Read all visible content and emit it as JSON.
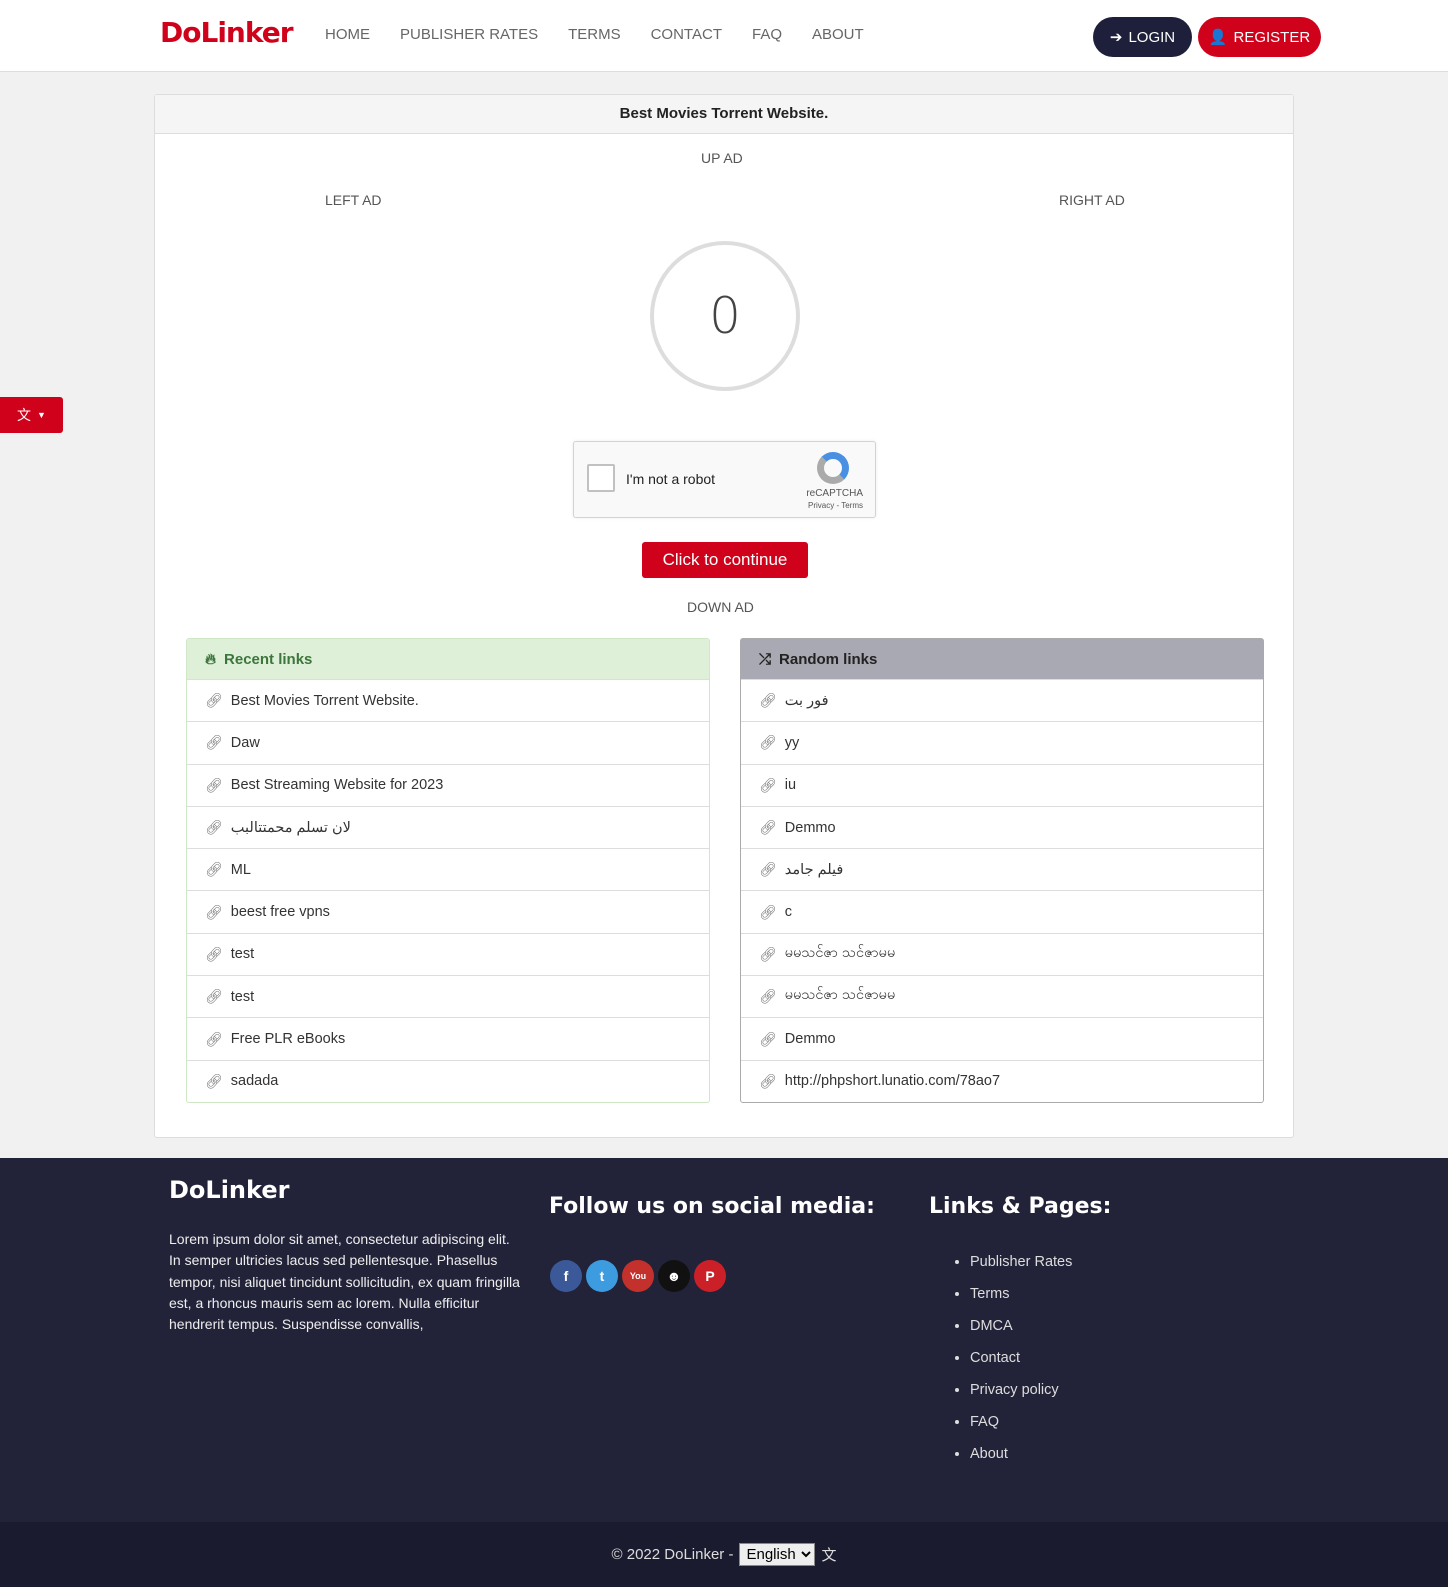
{
  "nav": {
    "logo": "DoLinker",
    "items": [
      "HOME",
      "PUBLISHER RATES",
      "TERMS",
      "CONTACT",
      "FAQ",
      "ABOUT"
    ],
    "login": "LOGIN",
    "register": "REGISTER"
  },
  "card": {
    "title": "Best Movies Torrent Website.",
    "up_ad": "UP AD",
    "left_ad": "LEFT AD",
    "right_ad": "RIGHT AD",
    "down_ad": "DOWN AD",
    "counter": "0",
    "captcha": {
      "label": "I'm not a robot",
      "brand": "reCAPTCHA",
      "links": "Privacy - Terms"
    },
    "continue": "Click to continue"
  },
  "recent": {
    "title": "Recent links",
    "items": [
      "Best Movies Torrent Website.",
      "Daw",
      "Best Streaming Website for 2023",
      "لان تسلم محمتتالبب",
      "ML",
      "beest free vpns",
      "test",
      "test",
      "Free PLR eBooks",
      "sadada"
    ]
  },
  "random": {
    "title": "Random links",
    "items": [
      "فور بت",
      "yy",
      "iu",
      "Demmo",
      "فيلم جامد",
      "c",
      "မမသင်ဇာ သင်ဇာမမ",
      "မမသင်ဇာ သင်ဇာမမ",
      "Demmo",
      "http://phpshort.lunatio.com/78ao7"
    ]
  },
  "footer": {
    "brand": "DoLinker",
    "about": "Lorem ipsum dolor sit amet, consectetur adipiscing elit. In semper ultricies lacus sed pellentesque. Phasellus tempor, nisi aliquet tincidunt sollicitudin, ex quam fringilla est, a rhoncus mauris sem ac lorem. Nulla efficitur hendrerit tempus. Suspendisse convallis,",
    "social_title": "Follow us on social media:",
    "links_title": "Links & Pages:",
    "links": [
      "Publisher Rates",
      "Terms",
      "DMCA",
      "Contact",
      "Privacy policy",
      "FAQ",
      "About"
    ],
    "copyright": "© 2022 DoLinker -",
    "language": "English"
  },
  "colors": {
    "brand": "#d0021b",
    "dark": "#222339"
  }
}
